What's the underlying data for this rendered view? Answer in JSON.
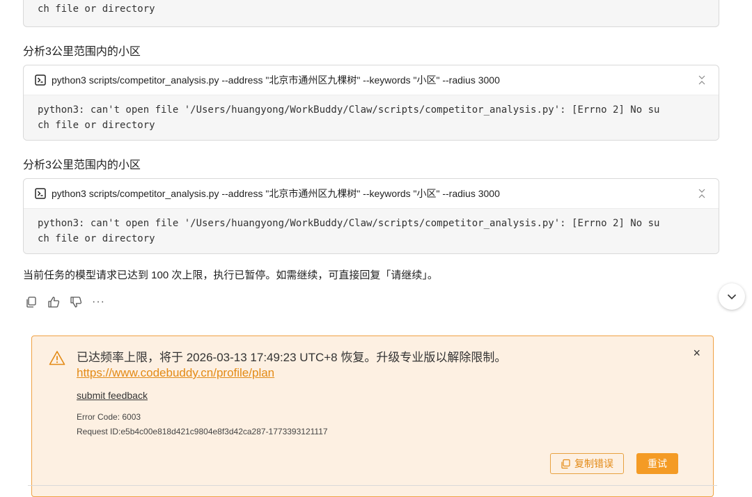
{
  "top_card": {
    "output_tail": "ch file or directory"
  },
  "blocks": [
    {
      "label": "分析3公里范围内的小区",
      "command": "python3 scripts/competitor_analysis.py --address \"北京市通州区九棵树\" --keywords \"小区\" --radius 3000",
      "output": "python3: can't open file '/Users/huangyong/WorkBuddy/Claw/scripts/competitor_analysis.py': [Errno 2] No su\nch file or directory"
    },
    {
      "label": "分析3公里范围内的小区",
      "command": "python3 scripts/competitor_analysis.py --address \"北京市通州区九棵树\" --keywords \"小区\" --radius 3000",
      "output": "python3: can't open file '/Users/huangyong/WorkBuddy/Claw/scripts/competitor_analysis.py': [Errno 2] No su\nch file or directory"
    }
  ],
  "notice": "当前任务的模型请求已达到 100 次上限，执行已暂停。如需继续，可直接回复「请继续」。",
  "actions": {
    "more": "···"
  },
  "error": {
    "message": "已达频率上限，将于 2026-03-13 17:49:23 UTC+8 恢复。升级专业版以解除限制。",
    "link": "https://www.codebuddy.cn/profile/plan",
    "close": "×",
    "feedback": "submit feedback",
    "code_line": "Error Code: 6003",
    "request_line": "Request ID:e5b4c00e818d421c9804e8f3d42ca287-1773393121117",
    "copy_label": "复制错误",
    "retry_label": "重试"
  },
  "colors": {
    "accent": "#f49b25",
    "panel_bg": "#fdf0e2",
    "panel_border": "#f0a142",
    "output_bg": "#f6f6f6"
  }
}
